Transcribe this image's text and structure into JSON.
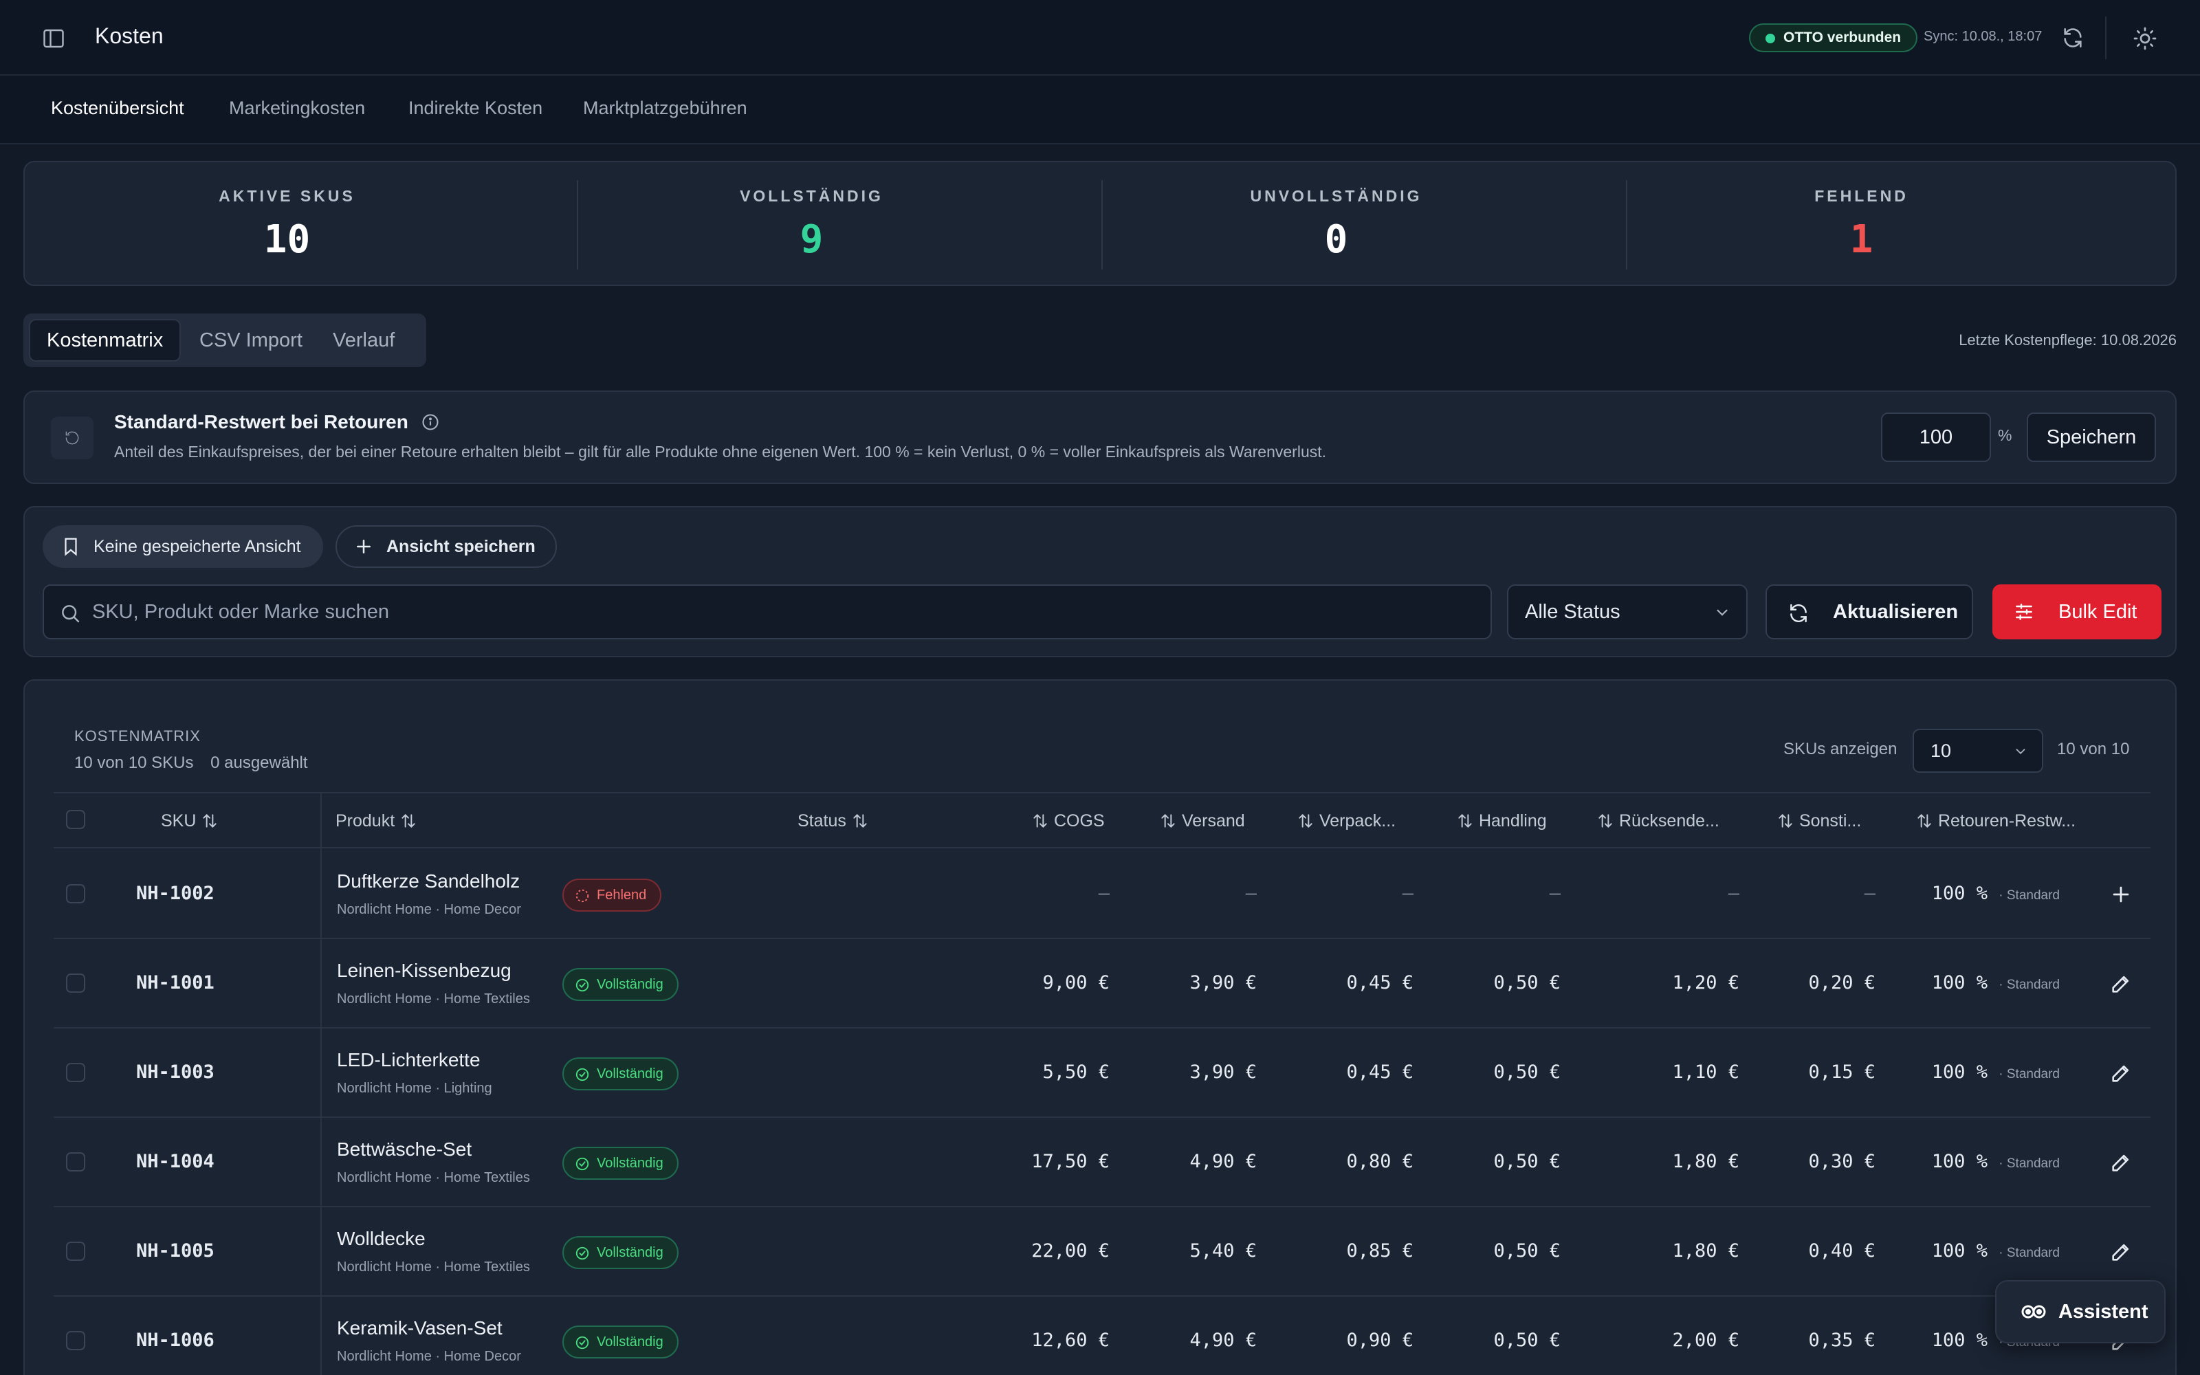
{
  "header": {
    "title": "Kosten",
    "connection_badge": "OTTO verbunden",
    "sync": "Sync: 10.08., 18:07"
  },
  "nav": {
    "tabs": [
      "Kostenübersicht",
      "Marketingkosten",
      "Indirekte Kosten",
      "Marktplatzgebühren"
    ],
    "active": 0
  },
  "kpis": [
    {
      "label": "AKTIVE SKUS",
      "value": "10",
      "color": "#ffffff"
    },
    {
      "label": "VOLLSTÄNDIG",
      "value": "9",
      "color": "#34d399"
    },
    {
      "label": "UNVOLLSTÄNDIG",
      "value": "0",
      "color": "#ffffff"
    },
    {
      "label": "FEHLEND",
      "value": "1",
      "color": "#f05252"
    }
  ],
  "segment_tabs": [
    "Kostenmatrix",
    "CSV Import",
    "Verlauf"
  ],
  "last_maintenance": "Letzte Kostenpflege: 10.08.2026",
  "restwert": {
    "title": "Standard-Restwert bei Retouren",
    "description": "Anteil des Einkaufspreises, der bei einer Retoure erhalten bleibt – gilt für alle Produkte ohne eigenen Wert. 100 % = kein Verlust, 0 % = voller Einkaufspreis als Warenverlust.",
    "value": "100",
    "unit": "%",
    "save_label": "Speichern"
  },
  "filters": {
    "no_view_label": "Keine gespeicherte Ansicht",
    "save_view_label": "Ansicht speichern",
    "search_placeholder": "SKU, Produkt oder Marke suchen",
    "status_select": "Alle Status",
    "refresh_label": "Aktualisieren",
    "bulk_label": "Bulk Edit"
  },
  "table": {
    "eyebrow": "KOSTENMATRIX",
    "count": "10 von 10 SKUs",
    "selected": "0 ausgewählt",
    "show_label": "SKUs anzeigen",
    "page_size": "10",
    "of_label": "10 von 10",
    "columns": [
      "SKU",
      "Produkt",
      "Status",
      "COGS",
      "Versand",
      "Verpack...",
      "Handling",
      "Rücksende...",
      "Sonsti...",
      "Retouren-Restw..."
    ],
    "rows": [
      {
        "sku": "NH-1002",
        "name": "Duftkerze Sandelholz",
        "meta": "Nordlicht Home · Home Decor",
        "status": "Fehlend",
        "status_kind": "miss",
        "cogs": "–",
        "versand": "–",
        "verpackung": "–",
        "handling": "–",
        "ruecksendung": "–",
        "sonstige": "–",
        "restwert": "100 %",
        "restwert_note": "· Standard",
        "action_icon": "plus-icon"
      },
      {
        "sku": "NH-1001",
        "name": "Leinen-Kissenbezug",
        "meta": "Nordlicht Home · Home Textiles",
        "status": "Vollständig",
        "status_kind": "ok",
        "cogs": "9,00 €",
        "versand": "3,90 €",
        "verpackung": "0,45 €",
        "handling": "0,50 €",
        "ruecksendung": "1,20 €",
        "sonstige": "0,20 €",
        "restwert": "100 %",
        "restwert_note": "· Standard",
        "action_icon": "pencil-icon"
      },
      {
        "sku": "NH-1003",
        "name": "LED-Lichterkette",
        "meta": "Nordlicht Home · Lighting",
        "status": "Vollständig",
        "status_kind": "ok",
        "cogs": "5,50 €",
        "versand": "3,90 €",
        "verpackung": "0,45 €",
        "handling": "0,50 €",
        "ruecksendung": "1,10 €",
        "sonstige": "0,15 €",
        "restwert": "100 %",
        "restwert_note": "· Standard",
        "action_icon": "pencil-icon"
      },
      {
        "sku": "NH-1004",
        "name": "Bettwäsche-Set",
        "meta": "Nordlicht Home · Home Textiles",
        "status": "Vollständig",
        "status_kind": "ok",
        "cogs": "17,50 €",
        "versand": "4,90 €",
        "verpackung": "0,80 €",
        "handling": "0,50 €",
        "ruecksendung": "1,80 €",
        "sonstige": "0,30 €",
        "restwert": "100 %",
        "restwert_note": "· Standard",
        "action_icon": "pencil-icon"
      },
      {
        "sku": "NH-1005",
        "name": "Wolldecke",
        "meta": "Nordlicht Home · Home Textiles",
        "status": "Vollständig",
        "status_kind": "ok",
        "cogs": "22,00 €",
        "versand": "5,40 €",
        "verpackung": "0,85 €",
        "handling": "0,50 €",
        "ruecksendung": "1,80 €",
        "sonstige": "0,40 €",
        "restwert": "100 %",
        "restwert_note": "· Standard",
        "action_icon": "pencil-icon"
      },
      {
        "sku": "NH-1006",
        "name": "Keramik-Vasen-Set",
        "meta": "Nordlicht Home · Home Decor",
        "status": "Vollständig",
        "status_kind": "ok",
        "cogs": "12,60 €",
        "versand": "4,90 €",
        "verpackung": "0,90 €",
        "handling": "0,50 €",
        "ruecksendung": "2,00 €",
        "sonstige": "0,35 €",
        "restwert": "100 %",
        "restwert_note": "· Standard",
        "action_icon": "pencil-icon"
      }
    ]
  },
  "assistant_label": "Assistent"
}
